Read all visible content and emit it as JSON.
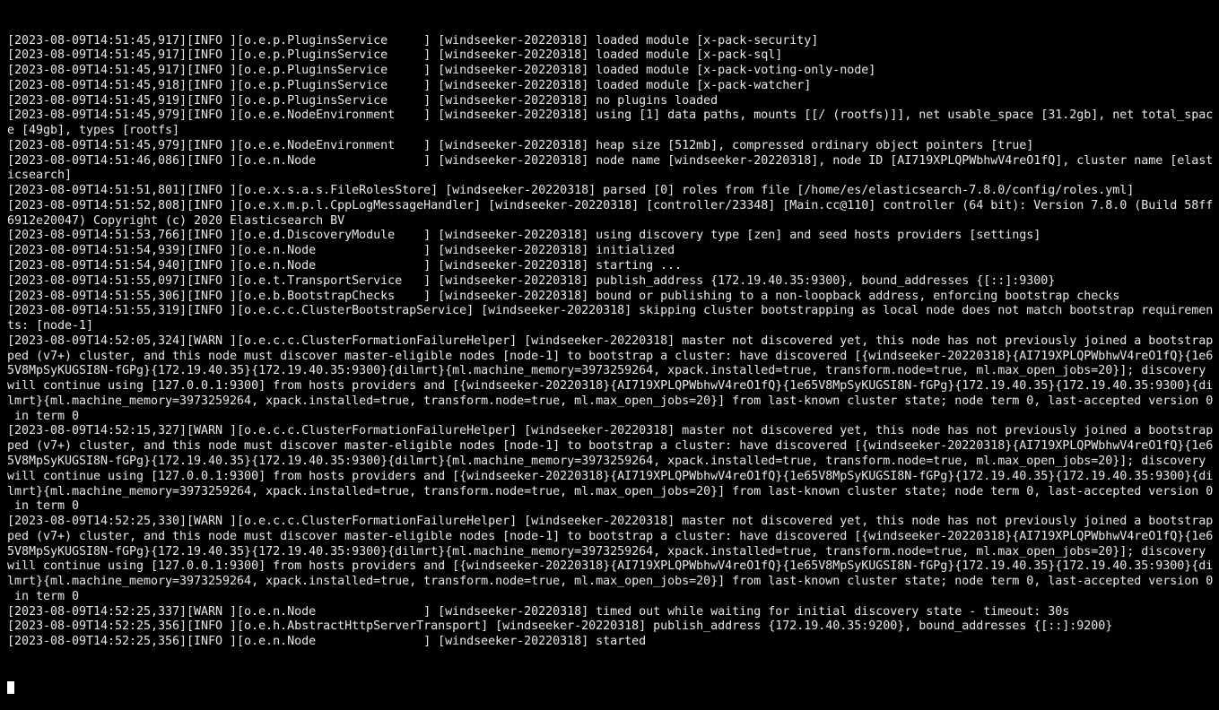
{
  "terminal": {
    "app": "elasticsearch-console-log",
    "foreground_color": "#e8e8e8",
    "background_color": "#000000",
    "cursor_color": "#ffffff",
    "font_size_px": 13.4,
    "columns": 168,
    "rows": 46,
    "cursor": {
      "visible": true,
      "row": 45,
      "column": 0,
      "shape": "block"
    },
    "node_name": "windseeker-20220318",
    "node_id": "AI719XPLQPWbhwV4reO1fQ",
    "ephemeral_id": "1e65V8MpSyKUGSI8N-fGPg",
    "cluster_name": "elasticsearch",
    "version": "7.8.0",
    "build": "58ff6912e20047",
    "publish_address_transport": "172.19.40.35:9300",
    "publish_address_http": "172.19.40.35:9200",
    "log_lines": [
      "[2023-08-09T14:51:45,917][INFO ][o.e.p.PluginsService     ] [windseeker-20220318] loaded module [x-pack-security]",
      "[2023-08-09T14:51:45,917][INFO ][o.e.p.PluginsService     ] [windseeker-20220318] loaded module [x-pack-sql]",
      "[2023-08-09T14:51:45,917][INFO ][o.e.p.PluginsService     ] [windseeker-20220318] loaded module [x-pack-voting-only-node]",
      "[2023-08-09T14:51:45,918][INFO ][o.e.p.PluginsService     ] [windseeker-20220318] loaded module [x-pack-watcher]",
      "[2023-08-09T14:51:45,919][INFO ][o.e.p.PluginsService     ] [windseeker-20220318] no plugins loaded",
      "[2023-08-09T14:51:45,979][INFO ][o.e.e.NodeEnvironment    ] [windseeker-20220318] using [1] data paths, mounts [[/ (rootfs)]], net usable_space [31.2gb], net total_space [49gb], types [rootfs]",
      "[2023-08-09T14:51:45,979][INFO ][o.e.e.NodeEnvironment    ] [windseeker-20220318] heap size [512mb], compressed ordinary object pointers [true]",
      "[2023-08-09T14:51:46,086][INFO ][o.e.n.Node               ] [windseeker-20220318] node name [windseeker-20220318], node ID [AI719XPLQPWbhwV4reO1fQ], cluster name [elasticsearch]",
      "[2023-08-09T14:51:51,801][INFO ][o.e.x.s.a.s.FileRolesStore] [windseeker-20220318] parsed [0] roles from file [/home/es/elasticsearch-7.8.0/config/roles.yml]",
      "[2023-08-09T14:51:52,808][INFO ][o.e.x.m.p.l.CppLogMessageHandler] [windseeker-20220318] [controller/23348] [Main.cc@110] controller (64 bit): Version 7.8.0 (Build 58ff6912e20047) Copyright (c) 2020 Elasticsearch BV",
      "[2023-08-09T14:51:53,766][INFO ][o.e.d.DiscoveryModule    ] [windseeker-20220318] using discovery type [zen] and seed hosts providers [settings]",
      "[2023-08-09T14:51:54,939][INFO ][o.e.n.Node               ] [windseeker-20220318] initialized",
      "[2023-08-09T14:51:54,940][INFO ][o.e.n.Node               ] [windseeker-20220318] starting ...",
      "[2023-08-09T14:51:55,097][INFO ][o.e.t.TransportService   ] [windseeker-20220318] publish_address {172.19.40.35:9300}, bound_addresses {[::]:9300}",
      "[2023-08-09T14:51:55,306][INFO ][o.e.b.BootstrapChecks    ] [windseeker-20220318] bound or publishing to a non-loopback address, enforcing bootstrap checks",
      "[2023-08-09T14:51:55,319][INFO ][o.e.c.c.ClusterBootstrapService] [windseeker-20220318] skipping cluster bootstrapping as local node does not match bootstrap requirements: [node-1]",
      "[2023-08-09T14:52:05,324][WARN ][o.e.c.c.ClusterFormationFailureHelper] [windseeker-20220318] master not discovered yet, this node has not previously joined a bootstrapped (v7+) cluster, and this node must discover master-eligible nodes [node-1] to bootstrap a cluster: have discovered [{windseeker-20220318}{AI719XPLQPWbhwV4reO1fQ}{1e65V8MpSyKUGSI8N-fGPg}{172.19.40.35}{172.19.40.35:9300}{dilmrt}{ml.machine_memory=3973259264, xpack.installed=true, transform.node=true, ml.max_open_jobs=20}]; discovery will continue using [127.0.0.1:9300] from hosts providers and [{windseeker-20220318}{AI719XPLQPWbhwV4reO1fQ}{1e65V8MpSyKUGSI8N-fGPg}{172.19.40.35}{172.19.40.35:9300}{dilmrt}{ml.machine_memory=3973259264, xpack.installed=true, transform.node=true, ml.max_open_jobs=20}] from last-known cluster state; node term 0, last-accepted version 0 in term 0",
      "[2023-08-09T14:52:15,327][WARN ][o.e.c.c.ClusterFormationFailureHelper] [windseeker-20220318] master not discovered yet, this node has not previously joined a bootstrapped (v7+) cluster, and this node must discover master-eligible nodes [node-1] to bootstrap a cluster: have discovered [{windseeker-20220318}{AI719XPLQPWbhwV4reO1fQ}{1e65V8MpSyKUGSI8N-fGPg}{172.19.40.35}{172.19.40.35:9300}{dilmrt}{ml.machine_memory=3973259264, xpack.installed=true, transform.node=true, ml.max_open_jobs=20}]; discovery will continue using [127.0.0.1:9300] from hosts providers and [{windseeker-20220318}{AI719XPLQPWbhwV4reO1fQ}{1e65V8MpSyKUGSI8N-fGPg}{172.19.40.35}{172.19.40.35:9300}{dilmrt}{ml.machine_memory=3973259264, xpack.installed=true, transform.node=true, ml.max_open_jobs=20}] from last-known cluster state; node term 0, last-accepted version 0 in term 0",
      "[2023-08-09T14:52:25,330][WARN ][o.e.c.c.ClusterFormationFailureHelper] [windseeker-20220318] master not discovered yet, this node has not previously joined a bootstrapped (v7+) cluster, and this node must discover master-eligible nodes [node-1] to bootstrap a cluster: have discovered [{windseeker-20220318}{AI719XPLQPWbhwV4reO1fQ}{1e65V8MpSyKUGSI8N-fGPg}{172.19.40.35}{172.19.40.35:9300}{dilmrt}{ml.machine_memory=3973259264, xpack.installed=true, transform.node=true, ml.max_open_jobs=20}]; discovery will continue using [127.0.0.1:9300] from hosts providers and [{windseeker-20220318}{AI719XPLQPWbhwV4reO1fQ}{1e65V8MpSyKUGSI8N-fGPg}{172.19.40.35}{172.19.40.35:9300}{dilmrt}{ml.machine_memory=3973259264, xpack.installed=true, transform.node=true, ml.max_open_jobs=20}] from last-known cluster state; node term 0, last-accepted version 0 in term 0",
      "[2023-08-09T14:52:25,337][WARN ][o.e.n.Node               ] [windseeker-20220318] timed out while waiting for initial discovery state - timeout: 30s",
      "[2023-08-09T14:52:25,356][INFO ][o.e.h.AbstractHttpServerTransport] [windseeker-20220318] publish_address {172.19.40.35:9200}, bound_addresses {[::]:9200}",
      "[2023-08-09T14:52:25,356][INFO ][o.e.n.Node               ] [windseeker-20220318] started"
    ]
  }
}
